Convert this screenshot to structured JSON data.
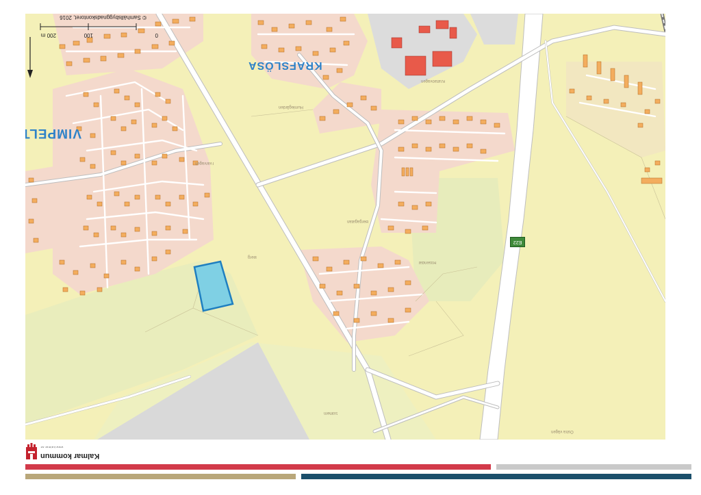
{
  "map": {
    "copyright": "© Samhällsbyggnadskontoret, 2016",
    "scale_unit_label": "200 m",
    "scale_ticks": [
      "100",
      "0"
    ],
    "place_names": [
      "VIMPELT",
      "KRAFSLÖSA"
    ],
    "road_shield": "E22",
    "small_labels": [
      "Tvärvägen",
      "Krafslövägen",
      "Bergagatan",
      "Humlegården",
      "Solhem",
      "Rosendal",
      "Berg",
      "Östra vägen"
    ],
    "highlighted_area_color": "#7fd0e4",
    "highlighted_area_border": "#1f7fc0"
  },
  "footer": {
    "organization": "Kalmar kommun",
    "website": "www.kalmar.se",
    "band_colors": [
      "#d23a4a",
      "#c9c9c9",
      "#b9a77a",
      "#1b4f6b"
    ]
  }
}
